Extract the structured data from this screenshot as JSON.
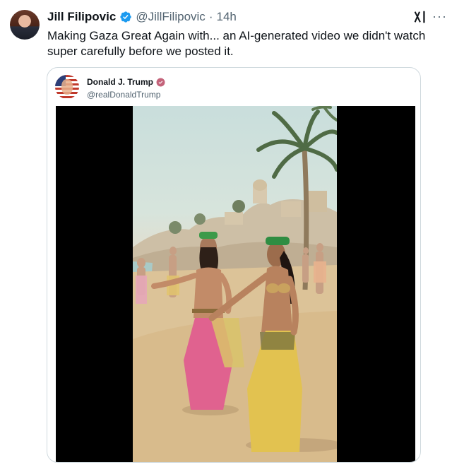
{
  "post": {
    "author_name": "Jill Filipovic",
    "handle": "@JillFilipovic",
    "separator": "·",
    "time": "14h",
    "text": "Making Gaza Great Again with... an AI-generated video we didn't watch super carefully before we posted it.",
    "more_label": "···"
  },
  "quoted_post": {
    "author_name": "Donald J. Trump",
    "handle": "@realDonaldTrump"
  },
  "icons": {
    "verified": "verified-badge-icon",
    "grok": "grok-icon",
    "more": "more-options-icon",
    "quoted_verified": "government-badge-icon"
  },
  "colors": {
    "verified_blue": "#1d9bf0",
    "quoted_badge": "#c4637a",
    "secondary_text": "#536471",
    "border": "#cfd9de"
  }
}
